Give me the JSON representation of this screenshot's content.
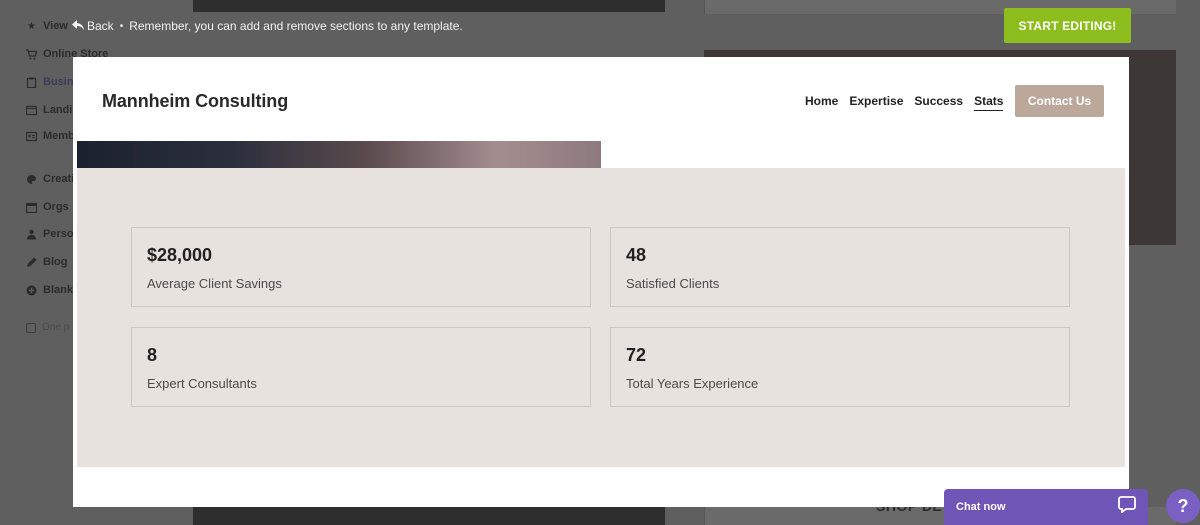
{
  "sidebar": {
    "items": [
      {
        "label": "View",
        "icon": "star-icon"
      },
      {
        "label": "Online Store",
        "icon": "cart-icon"
      },
      {
        "label": "Business",
        "icon": "clipboard-icon"
      },
      {
        "label": "Landing",
        "icon": "window-icon"
      },
      {
        "label": "Membership Courses",
        "icon": "id-card-icon"
      },
      {
        "label": "Creative",
        "icon": "palette-icon"
      },
      {
        "label": "Orgs",
        "icon": "calendar-icon"
      },
      {
        "label": "Personal",
        "icon": "person-icon"
      },
      {
        "label": "Blog",
        "icon": "pen-icon"
      },
      {
        "label": "Blank",
        "icon": "plus-circle-icon"
      }
    ],
    "checkbox_label": "One page"
  },
  "notice": {
    "back_label": "Back",
    "separator": "•",
    "message": "Remember, you can add and remove sections to any template."
  },
  "start_editing_label": "START EDITING!",
  "site": {
    "brand": "Mannheim Consulting",
    "nav": [
      {
        "label": "Home"
      },
      {
        "label": "Expertise"
      },
      {
        "label": "Success"
      },
      {
        "label": "Stats",
        "current": true
      }
    ],
    "contact_label": "Contact Us"
  },
  "stats": [
    {
      "value": "$28,000",
      "label": "Average Client Savings"
    },
    {
      "value": "48",
      "label": "Satisfied Clients"
    },
    {
      "value": "8",
      "label": "Expert Consultants"
    },
    {
      "value": "72",
      "label": "Total Years Experience"
    }
  ],
  "background": {
    "shop_text": "SHOP DE"
  },
  "chat": {
    "label": "Chat now",
    "help_symbol": "?"
  },
  "colors": {
    "start_button": "#8dbe1d",
    "contact_button": "#bca89b",
    "stats_background": "#e8e2de",
    "chat_purple": "#6f55b5"
  }
}
